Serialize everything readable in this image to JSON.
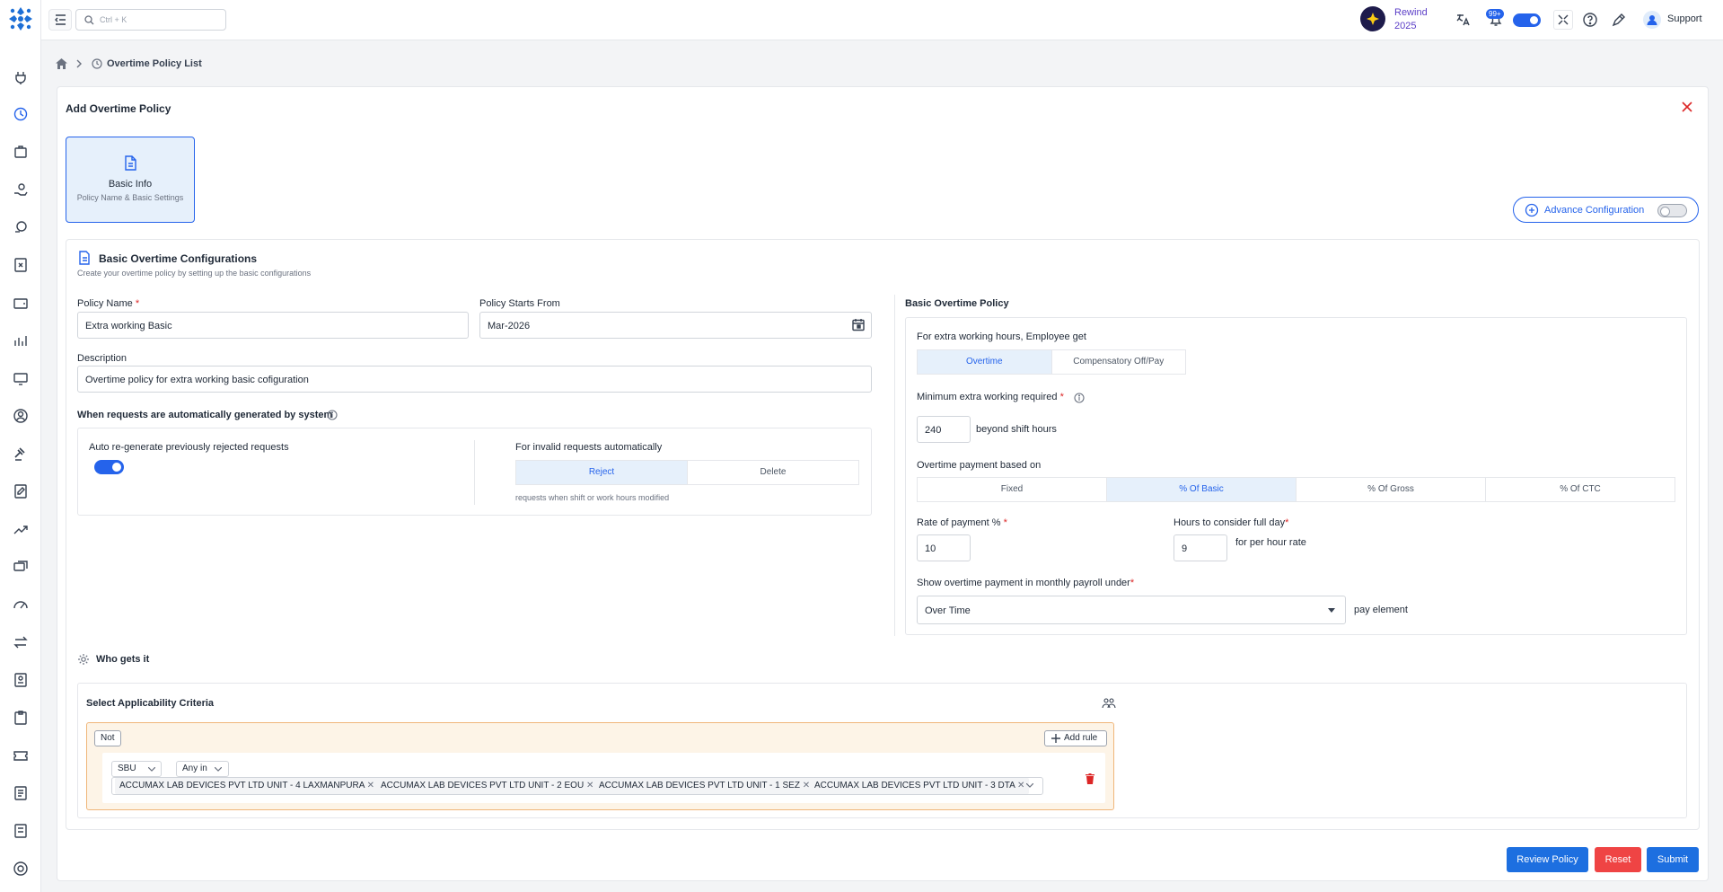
{
  "header": {
    "search_placeholder": "Ctrl + K",
    "rewind_line1": "Rewind",
    "rewind_line2": "2025",
    "notif_count": "99+",
    "support_label": "Support"
  },
  "breadcrumb": {
    "current": "Overtime Policy List"
  },
  "page": {
    "title": "Add Overtime Policy",
    "step_title": "Basic Info",
    "step_subtitle": "Policy Name & Basic Settings",
    "advance_config_label": "Advance Configuration",
    "advance_config_enabled": false
  },
  "basic": {
    "title": "Basic Overtime Configurations",
    "subtitle": "Create your overtime policy by setting up the basic configurations",
    "policy_name_label": "Policy Name",
    "policy_name_value": "Extra working Basic",
    "starts_from_label": "Policy Starts From",
    "starts_from_value": "Mar-2026",
    "description_label": "Description",
    "description_value": "Overtime policy for extra working basic cofiguration",
    "auto_title": "When requests are automatically generated by system",
    "auto_regen_label": "Auto re-generate previously rejected requests",
    "auto_regen_enabled": true,
    "invalid_label": "For invalid requests automatically",
    "invalid_options": [
      "Reject",
      "Delete"
    ],
    "invalid_selected": "Reject",
    "invalid_hint": "requests when shift or work hours modified"
  },
  "policy": {
    "title": "Basic Overtime Policy",
    "extra_label": "For extra working hours, Employee get",
    "extra_options": [
      "Overtime",
      "Compensatory Off/Pay"
    ],
    "extra_selected": "Overtime",
    "min_label": "Minimum extra working required",
    "min_value": "240",
    "min_suffix": "beyond shift hours",
    "payment_label": "Overtime payment based on",
    "payment_options": [
      "Fixed",
      "% Of Basic",
      "% Of Gross",
      "% Of CTC"
    ],
    "payment_selected": "% Of Basic",
    "rate_label": "Rate of payment %",
    "rate_value": "10",
    "hours_label": "Hours to consider full day",
    "hours_value": "9",
    "hours_suffix": "for per hour rate",
    "payroll_label": "Show overtime payment in monthly payroll under",
    "payroll_value": "Over Time",
    "payroll_suffix": "pay element"
  },
  "who": {
    "title": "Who gets it",
    "criteria_title": "Select Applicability Criteria",
    "not_label": "Not",
    "add_rule_label": "Add rule",
    "field_value": "SBU",
    "operator_value": "Any in",
    "tags": [
      "ACCUMAX LAB DEVICES PVT LTD UNIT - 4 LAXMANPURA",
      "ACCUMAX LAB DEVICES PVT LTD UNIT - 2 EOU",
      "ACCUMAX LAB DEVICES PVT LTD UNIT - 1 SEZ",
      "ACCUMAX LAB DEVICES PVT LTD UNIT - 3 DTA"
    ]
  },
  "actions": {
    "review_label": "Review Policy",
    "reset_label": "Reset",
    "submit_label": "Submit"
  },
  "colors": {
    "primary": "#2563eb",
    "danger": "#ef4444",
    "active_bg": "#e6f0fb",
    "rule_bg": "#fdf4e7"
  }
}
